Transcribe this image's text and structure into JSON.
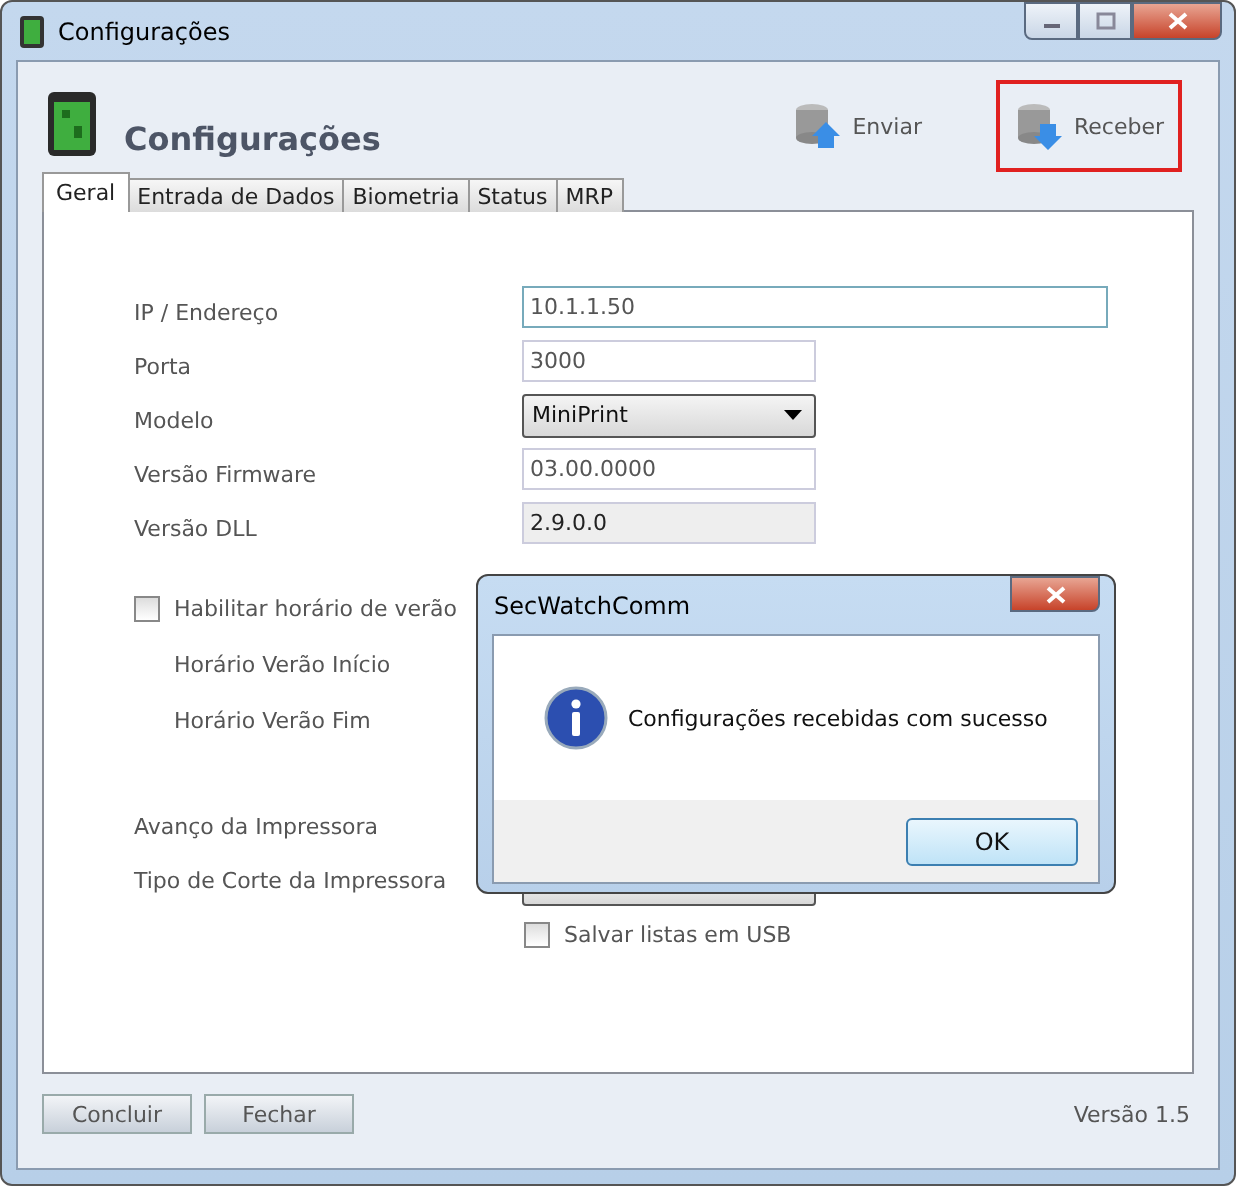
{
  "window": {
    "title": "Configurações",
    "controls": [
      {
        "kind": "minimize"
      },
      {
        "kind": "maximize"
      },
      {
        "kind": "close"
      }
    ]
  },
  "header": {
    "title": "Configurações",
    "actions": [
      {
        "label": "Enviar",
        "kind": "upload",
        "highlighted": false
      },
      {
        "label": "Receber",
        "kind": "download",
        "highlighted": true
      }
    ]
  },
  "tabs": [
    {
      "label": "Geral",
      "selected": true
    },
    {
      "label": "Entrada de Dados",
      "selected": false
    },
    {
      "label": "Biometria",
      "selected": false
    },
    {
      "label": "Status",
      "selected": false
    },
    {
      "label": "MRP",
      "selected": false
    }
  ],
  "fields": [
    {
      "label": "IP / Endereço",
      "kind": "text",
      "value": "10.1.1.50"
    },
    {
      "label": "Porta",
      "kind": "text",
      "value": "3000"
    },
    {
      "label": "Modelo",
      "kind": "select",
      "value": "MiniPrint"
    },
    {
      "label": "Versão Firmware",
      "kind": "text",
      "value": "03.00.0000"
    },
    {
      "label": "Versão DLL",
      "kind": "readonly",
      "value": "2.9.0.0"
    }
  ],
  "dst": {
    "label": "Habilitar horário de verão",
    "checked": false,
    "sublabels": [
      "Horário Verão Início",
      "Horário Verão Fim"
    ]
  },
  "printer_fields": [
    {
      "label": "Avanço da Impressora",
      "kind": "hidden"
    },
    {
      "label": "Tipo de Corte da Impressora",
      "kind": "select"
    }
  ],
  "usb": {
    "label": "Salvar listas em USB",
    "checked": false
  },
  "footer": {
    "buttons": [
      "Concluir",
      "Fechar"
    ],
    "version": "Versão 1.5"
  },
  "dialog": {
    "title": "SecWatchComm",
    "message": "Configurações recebidas com sucesso",
    "button": "OK"
  }
}
